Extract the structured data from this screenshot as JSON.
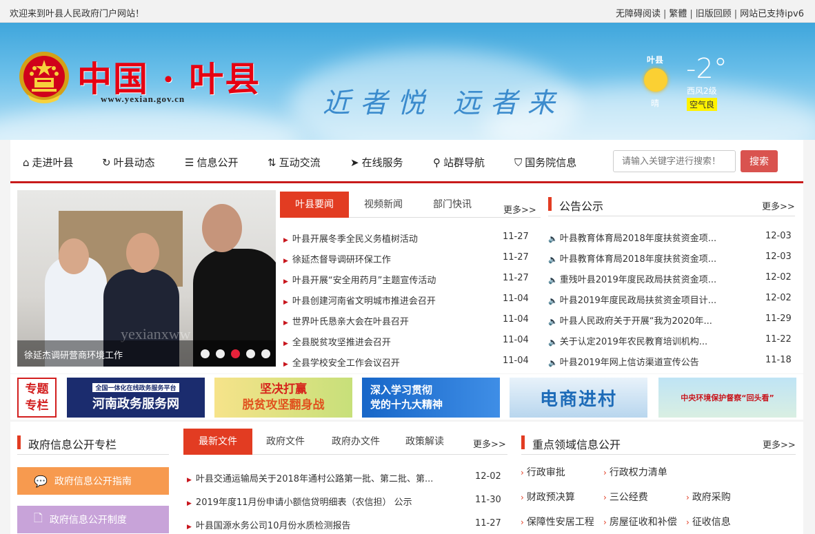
{
  "topbar": {
    "welcome": "欢迎来到叶县人民政府门户网站！",
    "links": [
      "无障碍阅读",
      "繁體",
      "旧版回顾",
      "网站已支持ipv6"
    ]
  },
  "header": {
    "site_title": "中国 · 叶县",
    "site_url": "www.yexian.gov.cn",
    "slogan": "近者悦 远者来",
    "weather": {
      "city": "叶县",
      "condition": "晴",
      "temperature": "-2°",
      "wind": "西风2级",
      "aqi": "空气良"
    }
  },
  "nav": {
    "items": [
      {
        "label": "走进叶县",
        "icon": "home-icon",
        "glyph": "⌂"
      },
      {
        "label": "叶县动态",
        "icon": "refresh-icon",
        "glyph": "↻"
      },
      {
        "label": "信息公开",
        "icon": "list-icon",
        "glyph": "☰"
      },
      {
        "label": "互动交流",
        "icon": "exchange-icon",
        "glyph": "⇅"
      },
      {
        "label": "在线服务",
        "icon": "send-icon",
        "glyph": "➤"
      },
      {
        "label": "站群导航",
        "icon": "map-marker-icon",
        "glyph": "⚲"
      },
      {
        "label": "国务院信息",
        "icon": "tag-icon",
        "glyph": "⛉"
      }
    ],
    "search_placeholder": "请输入关键字进行搜索！",
    "search_label": "搜索"
  },
  "slider": {
    "caption": "徐延杰调研营商环境工作",
    "watermark": "yexianxww",
    "dot_count": 5,
    "active_dot": 3
  },
  "news": {
    "tabs": [
      "叶县要闻",
      "视频新闻",
      "部门快讯"
    ],
    "more": "更多>>",
    "items": [
      {
        "title": "叶县开展冬季全民义务植树活动",
        "date": "11-27"
      },
      {
        "title": "徐延杰督导调研环保工作",
        "date": "11-27"
      },
      {
        "title": "叶县开展“安全用药月”主题宣传活动",
        "date": "11-27"
      },
      {
        "title": "叶县创建河南省文明城市推进会召开",
        "date": "11-04"
      },
      {
        "title": "世界叶氏恳亲大会在叶县召开",
        "date": "11-04"
      },
      {
        "title": "全县脱贫攻坚推进会召开",
        "date": "11-04"
      },
      {
        "title": "全县学校安全工作会议召开",
        "date": "11-04"
      }
    ]
  },
  "notices": {
    "title": "公告公示",
    "more": "更多>>",
    "items": [
      {
        "title": "叶县教育体育局2018年度扶贫资金项...",
        "date": "12-03"
      },
      {
        "title": "叶县教育体育局2018年度扶贫资金项...",
        "date": "12-03"
      },
      {
        "title": "重残叶县2019年度民政局扶贫资金项...",
        "date": "12-02"
      },
      {
        "title": "叶县2019年度民政局扶贫资金项目计...",
        "date": "12-02"
      },
      {
        "title": "叶县人民政府关于开展“我为2020年...",
        "date": "11-29"
      },
      {
        "title": "关于认定2019年农民教育培训机构...",
        "date": "11-22"
      },
      {
        "title": "叶县2019年网上信访渠道宣传公告",
        "date": "11-18"
      }
    ]
  },
  "banners": {
    "special_line1": "专题",
    "special_line2": "专栏",
    "items": [
      {
        "top": "全国一体化在线政务服务平台",
        "main": "河南政务服务网"
      },
      {
        "top": "坚决打赢",
        "main": "脱贫攻坚翻身战"
      },
      {
        "top": "深入学习贯彻",
        "main": "党的十九大精神"
      },
      {
        "top": "",
        "main": "电商进村"
      },
      {
        "top": "",
        "main": "中央环境保护督察“回头看”"
      }
    ]
  },
  "gov_info": {
    "title": "政府信息公开专栏",
    "buttons": [
      "政府信息公开指南",
      "政府信息公开制度"
    ]
  },
  "files": {
    "tabs": [
      "最新文件",
      "政府文件",
      "政府办文件",
      "政策解读"
    ],
    "more": "更多>>",
    "items": [
      {
        "title": "叶县交通运输局关于2018年通村公路第一批、第二批、第...",
        "date": "12-02"
      },
      {
        "title": "2019年度11月份申请小额信贷明细表（农信担） 公示",
        "date": "11-30"
      },
      {
        "title": "叶县国源水务公司10月份水质检测报告",
        "date": "11-27"
      }
    ]
  },
  "key_areas": {
    "title": "重点领域信息公开",
    "more": "更多>>",
    "tags": [
      [
        "行政审批",
        "行政权力清单"
      ],
      [
        "财政预决算",
        "三公经费",
        "政府采购"
      ],
      [
        "保障性安居工程",
        "房屋征收和补偿",
        "征收信息"
      ]
    ]
  },
  "colors": {
    "accent_red": "#e23c22",
    "nav_red": "#c81b1b",
    "orange_button": "#f79a4f",
    "purple_button": "#c8a3d9",
    "search_button": "#d9534f"
  }
}
